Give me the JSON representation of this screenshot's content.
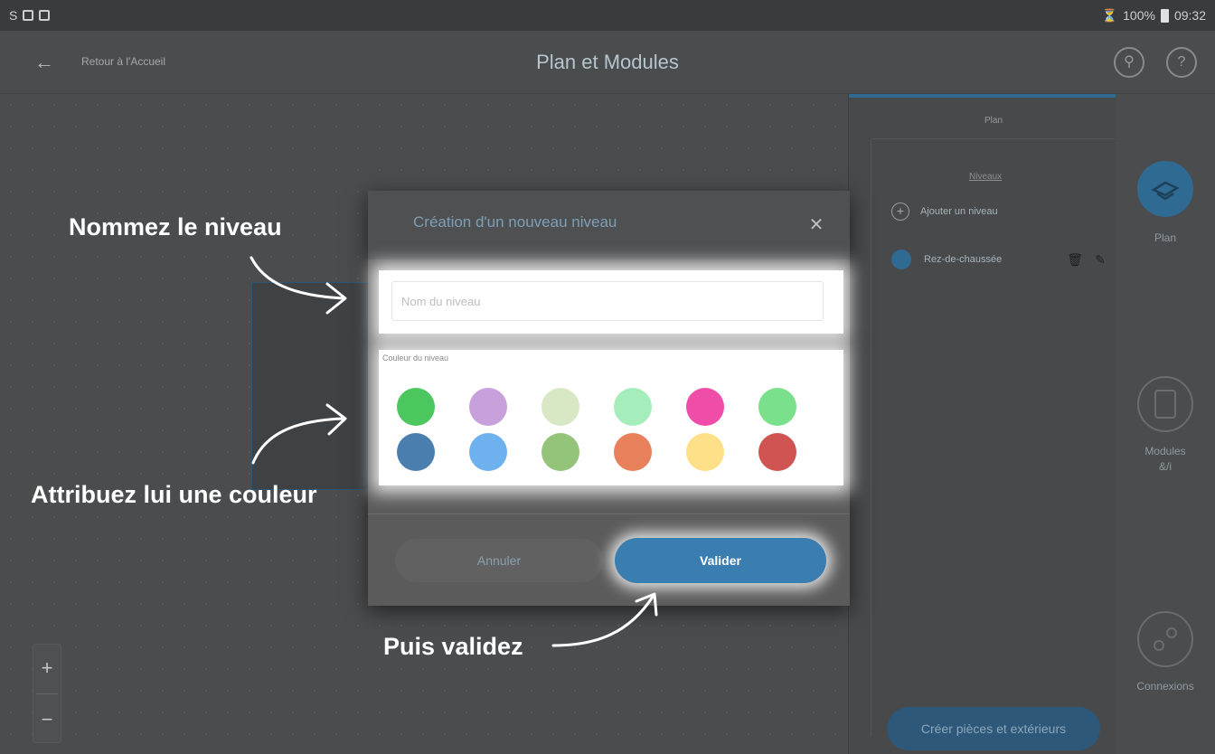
{
  "status_bar": {
    "left_glyph": "S",
    "battery_percent": "100%",
    "time": "09:32"
  },
  "app_bar": {
    "back_label": "Retour à l'Accueil",
    "title": "Plan et Modules"
  },
  "panel": {
    "tab_label": "Plan",
    "niveaux_title": "Niveaux",
    "add_level_label": "Ajouter un niveau",
    "levels": [
      {
        "name": "Rez-de-chaussée",
        "color": "#2f6a93"
      }
    ],
    "create_button_label": "Créer pièces et extérieurs"
  },
  "rail": {
    "items": [
      {
        "label": "Plan",
        "icon": "plan-icon",
        "active": true
      },
      {
        "label": "Modules",
        "label2": "&/i",
        "icon": "modules-icon",
        "active": false
      },
      {
        "label": "Connexions",
        "icon": "connexions-icon",
        "active": false
      }
    ]
  },
  "zoom": {
    "plus": "+",
    "minus": "−"
  },
  "dialog": {
    "title": "Création d'un nouveau niveau",
    "name_placeholder": "Nom du niveau",
    "name_value": "",
    "color_label": "Couleur du niveau",
    "colors": [
      "#4cc65f",
      "#c7a0dc",
      "#d9e8c4",
      "#a5eebb",
      "#ef4da8",
      "#7ae08c",
      "#4a7eaf",
      "#6db1ef",
      "#94c479",
      "#e8805c",
      "#fde087",
      "#cf5451"
    ],
    "cancel_label": "Annuler",
    "validate_label": "Valider"
  },
  "annotations": {
    "name_hint": "Nommez le niveau",
    "color_hint": "Attribuez lui une couleur",
    "validate_hint": "Puis validez"
  }
}
